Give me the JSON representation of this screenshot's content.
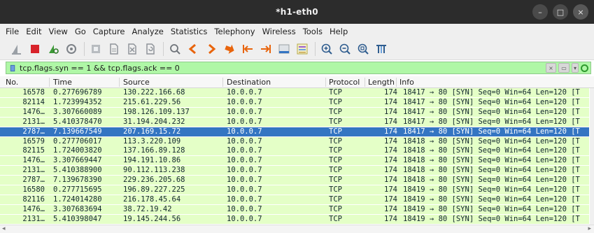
{
  "window": {
    "title": "*h1-eth0",
    "controls": {
      "minimize": "–",
      "maximize": "□",
      "close": "×"
    }
  },
  "menu": [
    "File",
    "Edit",
    "View",
    "Go",
    "Capture",
    "Analyze",
    "Statistics",
    "Telephony",
    "Wireless",
    "Tools",
    "Help"
  ],
  "toolbar": {
    "icons": [
      "shark-fin-start-icon",
      "stop-capture-icon",
      "restart-capture-icon",
      "capture-options-icon",
      "open-file-icon",
      "save-file-icon",
      "close-file-icon",
      "reload-file-icon",
      "find-packet-icon",
      "go-back-icon",
      "go-forward-icon",
      "go-to-packet-icon",
      "go-first-icon",
      "go-last-icon",
      "autoscroll-icon",
      "colorize-icon",
      "zoom-in-icon",
      "zoom-out-icon",
      "zoom-normal-icon",
      "resize-columns-icon"
    ]
  },
  "filter": {
    "expression": "tcp.flags.syn == 1 && tcp.flags.ack == 0",
    "accent": "#aff7a6"
  },
  "columns": [
    "No.",
    "Time",
    "Source",
    "Destination",
    "Protocol",
    "Length",
    "Info"
  ],
  "packets": [
    {
      "no": "16578",
      "time": "0.277696789",
      "src": "130.222.166.68",
      "dst": "10.0.0.7",
      "proto": "TCP",
      "len": "174",
      "info": "18417 → 80 [SYN] Seq=0 Win=64 Len=120 [T",
      "selected": false
    },
    {
      "no": "82114",
      "time": "1.723994352",
      "src": "215.61.229.56",
      "dst": "10.0.0.7",
      "proto": "TCP",
      "len": "174",
      "info": "18417 → 80 [SYN] Seq=0 Win=64 Len=120 [T",
      "selected": false
    },
    {
      "no": "1476…",
      "time": "3.307660089",
      "src": "198.126.109.137",
      "dst": "10.0.0.7",
      "proto": "TCP",
      "len": "174",
      "info": "18417 → 80 [SYN] Seq=0 Win=64 Len=120 [T",
      "selected": false
    },
    {
      "no": "2131…",
      "time": "5.410378470",
      "src": "31.194.204.232",
      "dst": "10.0.0.7",
      "proto": "TCP",
      "len": "174",
      "info": "18417 → 80 [SYN] Seq=0 Win=64 Len=120 [T",
      "selected": false
    },
    {
      "no": "2787…",
      "time": "7.139667549",
      "src": "207.169.15.72",
      "dst": "10.0.0.7",
      "proto": "TCP",
      "len": "174",
      "info": "18417 → 80 [SYN] Seq=0 Win=64 Len=120 [T",
      "selected": true
    },
    {
      "no": "16579",
      "time": "0.277706017",
      "src": "113.3.220.109",
      "dst": "10.0.0.7",
      "proto": "TCP",
      "len": "174",
      "info": "18418 → 80 [SYN] Seq=0 Win=64 Len=120 [T",
      "selected": false
    },
    {
      "no": "82115",
      "time": "1.724003820",
      "src": "137.166.89.128",
      "dst": "10.0.0.7",
      "proto": "TCP",
      "len": "174",
      "info": "18418 → 80 [SYN] Seq=0 Win=64 Len=120 [T",
      "selected": false
    },
    {
      "no": "1476…",
      "time": "3.307669447",
      "src": "194.191.10.86",
      "dst": "10.0.0.7",
      "proto": "TCP",
      "len": "174",
      "info": "18418 → 80 [SYN] Seq=0 Win=64 Len=120 [T",
      "selected": false
    },
    {
      "no": "2131…",
      "time": "5.410388900",
      "src": "90.112.113.238",
      "dst": "10.0.0.7",
      "proto": "TCP",
      "len": "174",
      "info": "18418 → 80 [SYN] Seq=0 Win=64 Len=120 [T",
      "selected": false
    },
    {
      "no": "2787…",
      "time": "7.139678390",
      "src": "229.236.205.68",
      "dst": "10.0.0.7",
      "proto": "TCP",
      "len": "174",
      "info": "18418 → 80 [SYN] Seq=0 Win=64 Len=120 [T",
      "selected": false
    },
    {
      "no": "16580",
      "time": "0.277715695",
      "src": "196.89.227.225",
      "dst": "10.0.0.7",
      "proto": "TCP",
      "len": "174",
      "info": "18419 → 80 [SYN] Seq=0 Win=64 Len=120 [T",
      "selected": false
    },
    {
      "no": "82116",
      "time": "1.724014280",
      "src": "216.178.45.64",
      "dst": "10.0.0.7",
      "proto": "TCP",
      "len": "174",
      "info": "18419 → 80 [SYN] Seq=0 Win=64 Len=120 [T",
      "selected": false
    },
    {
      "no": "1476…",
      "time": "3.307683694",
      "src": "38.72.19.42",
      "dst": "10.0.0.7",
      "proto": "TCP",
      "len": "174",
      "info": "18419 → 80 [SYN] Seq=0 Win=64 Len=120 [T",
      "selected": false
    },
    {
      "no": "2131…",
      "time": "5.410398047",
      "src": "19.145.244.56",
      "dst": "10.0.0.7",
      "proto": "TCP",
      "len": "174",
      "info": "18419 → 80 [SYN] Seq=0 Win=64 Len=120 [T",
      "selected": false
    }
  ],
  "colors": {
    "row_bg": "#e4ffc7",
    "selected_bg": "#3475c2",
    "titlebar_bg": "#2c2c2c"
  }
}
